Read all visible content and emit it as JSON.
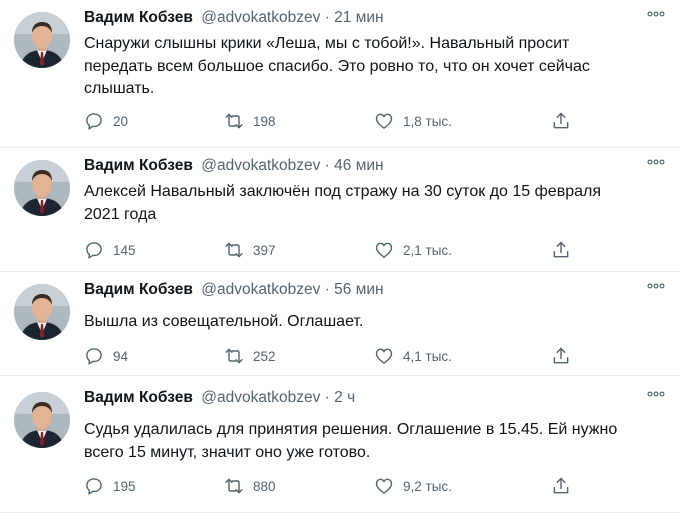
{
  "tweets": [
    {
      "name": "Вадим Кобзев",
      "handle": "@advokatkobzev",
      "sep": "·",
      "time": "21 мин",
      "text": "Снаружи слышны крики «Леша, мы с тобой!». Навальный просит\nпередать всем большое спасибо. Это ровно то, что он хочет сейчас\nслышать.",
      "replies": "20",
      "retweets": "198",
      "likes": "1,8 тыс."
    },
    {
      "name": "Вадим Кобзев",
      "handle": "@advokatkobzev",
      "sep": "·",
      "time": "46 мин",
      "text": "Алексей Навальный заключён под стражу на 30 суток до 15 февраля\n2021 года",
      "replies": "145",
      "retweets": "397",
      "likes": "2,1 тыс."
    },
    {
      "name": "Вадим Кобзев",
      "handle": "@advokatkobzev",
      "sep": "·",
      "time": "56 мин",
      "text": "Вышла из совещательной. Оглашает.",
      "replies": "94",
      "retweets": "252",
      "likes": "4,1 тыс."
    },
    {
      "name": "Вадим Кобзев",
      "handle": "@advokatkobzev",
      "sep": "·",
      "time": "2 ч",
      "text": "Судья удалилась для принятия решения. Оглашение в 15.45. Ей нужно\nвсего 15 минут, значит оно уже готово.",
      "replies": "195",
      "retweets": "880",
      "likes": "9,2 тыс."
    }
  ],
  "icons": {
    "more": "more-dots-icon",
    "reply": "reply-icon",
    "retweet": "retweet-icon",
    "like": "like-heart-icon",
    "share": "share-icon"
  },
  "colors": {
    "secondary_text": "#536471",
    "primary_text": "#0f1419",
    "divider": "#e6ecf0"
  }
}
